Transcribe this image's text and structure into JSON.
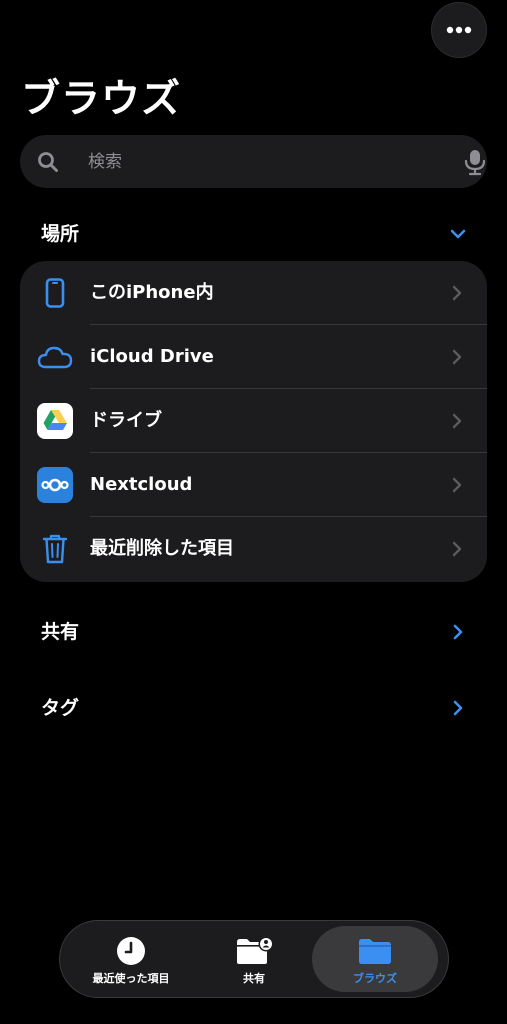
{
  "header": {
    "title": "ブラウズ",
    "more_icon": "ellipsis-icon"
  },
  "search": {
    "placeholder": "検索",
    "icon": "magnifying-glass-icon",
    "mic_icon": "microphone-icon"
  },
  "sections": {
    "locations": {
      "label": "場所",
      "expanded": true,
      "items": [
        {
          "label": "このiPhone内",
          "icon": "iphone-icon"
        },
        {
          "label": "iCloud Drive",
          "icon": "icloud-icon"
        },
        {
          "label": "ドライブ",
          "icon": "google-drive-icon"
        },
        {
          "label": "Nextcloud",
          "icon": "nextcloud-icon"
        },
        {
          "label": "最近削除した項目",
          "icon": "trash-icon"
        }
      ]
    },
    "shared": {
      "label": "共有"
    },
    "tags": {
      "label": "タグ"
    }
  },
  "tabbar": {
    "tabs": [
      {
        "label": "最近使った項目",
        "icon": "clock-icon",
        "active": false
      },
      {
        "label": "共有",
        "icon": "shared-folder-icon",
        "active": false
      },
      {
        "label": "ブラウズ",
        "icon": "folder-icon",
        "active": true
      }
    ]
  },
  "colors": {
    "accent": "#3b8ff0",
    "background": "#000000",
    "card": "#1c1c1e",
    "secondary_text": "#8d8d93",
    "chevron_gray": "#5a5a5e"
  }
}
